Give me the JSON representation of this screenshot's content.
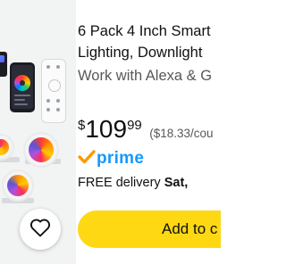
{
  "product": {
    "title_lines": [
      "6 Pack 4 Inch Smart",
      "Lighting, Downlight"
    ],
    "subtitle": "Work with Alexa & G",
    "price": {
      "symbol": "$",
      "whole": "109",
      "fraction": "99",
      "unit_price": "($18.33/cou"
    },
    "prime_label": "prime",
    "delivery": {
      "prefix": "FREE delivery ",
      "day": "Sat,"
    },
    "add_to_cart_label": "Add to c"
  },
  "colors": {
    "prime_blue": "#1399ff",
    "prime_check": "#ff9900",
    "cart_button": "#ffd814",
    "text_primary": "#0f1111",
    "text_secondary": "#565959"
  },
  "icons": {
    "wishlist": "heart-icon",
    "prime": "prime-check-icon"
  }
}
